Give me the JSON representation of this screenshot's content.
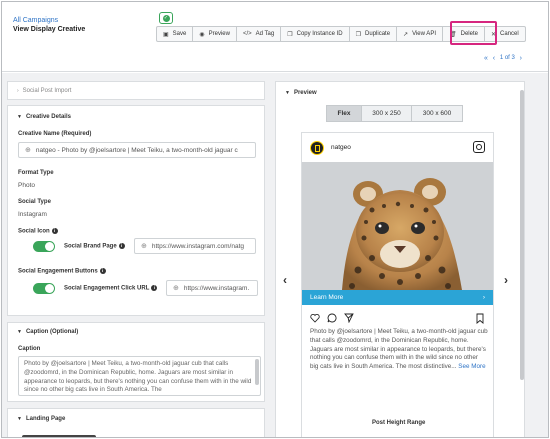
{
  "header": {
    "breadcrumb": "All Campaigns",
    "title": "View Display Creative"
  },
  "toolbar": {
    "save": "Save",
    "preview": "Preview",
    "ad_tag": "Ad Tag",
    "copy_instance_id": "Copy Instance ID",
    "duplicate": "Duplicate",
    "view_api": "View API",
    "delete": "Delete",
    "cancel": "Cancel"
  },
  "pager": {
    "label": "1 of 3"
  },
  "sections": {
    "social_post_import": "Social Post Import",
    "creative_details": "Creative Details",
    "caption": "Caption (Optional)",
    "landing_page": "Landing Page"
  },
  "creative_details": {
    "name_label": "Creative Name (Required)",
    "name_value": "natgeo - Photo by @joelsartore | Meet Teiku, a two-month-old jaguar c",
    "format_label": "Format Type",
    "format_value": "Photo",
    "social_type_label": "Social Type",
    "social_type_value": "Instagram",
    "social_icon_label": "Social Icon",
    "brand_page_label": "Social Brand Page",
    "brand_page_url": "https://www.instagram.com/natg",
    "engagement_label": "Social Engagement Buttons",
    "engagement_click_label": "Social Engagement Click URL",
    "engagement_url": "https://www.instagram."
  },
  "caption": {
    "label": "Caption",
    "text": "Photo by @joelsartore | Meet Teiku, a two-month-old jaguar cub that calls @zoodomrd, in the Dominican Republic, home. Jaguars are most similar in appearance to leopards, but there's nothing you can confuse them with in the wild since no other big cats live in South America. The"
  },
  "preview": {
    "title": "Preview",
    "sizes": [
      "Flex",
      "300 x 250",
      "300 x 600"
    ],
    "selected_size": "Flex",
    "account": "natgeo",
    "cta": "Learn More",
    "caption_text": "Photo by @joelsartore | Meet Teiku, a two-month-old jaguar cub that calls @zoodomrd, in the Dominican Republic, home. Jaguars are most similar in appearance to leopards, but there's nothing you can confuse them with in the wild since no other big cats live in South America. The most distinctive...",
    "see_more": "See More",
    "post_height_label": "Post Height Range"
  },
  "colors": {
    "link": "#2f74c6",
    "toggle_on": "#3aa55a",
    "cta_bar": "#2ba4d6",
    "delete_highlight": "#d6267f"
  }
}
